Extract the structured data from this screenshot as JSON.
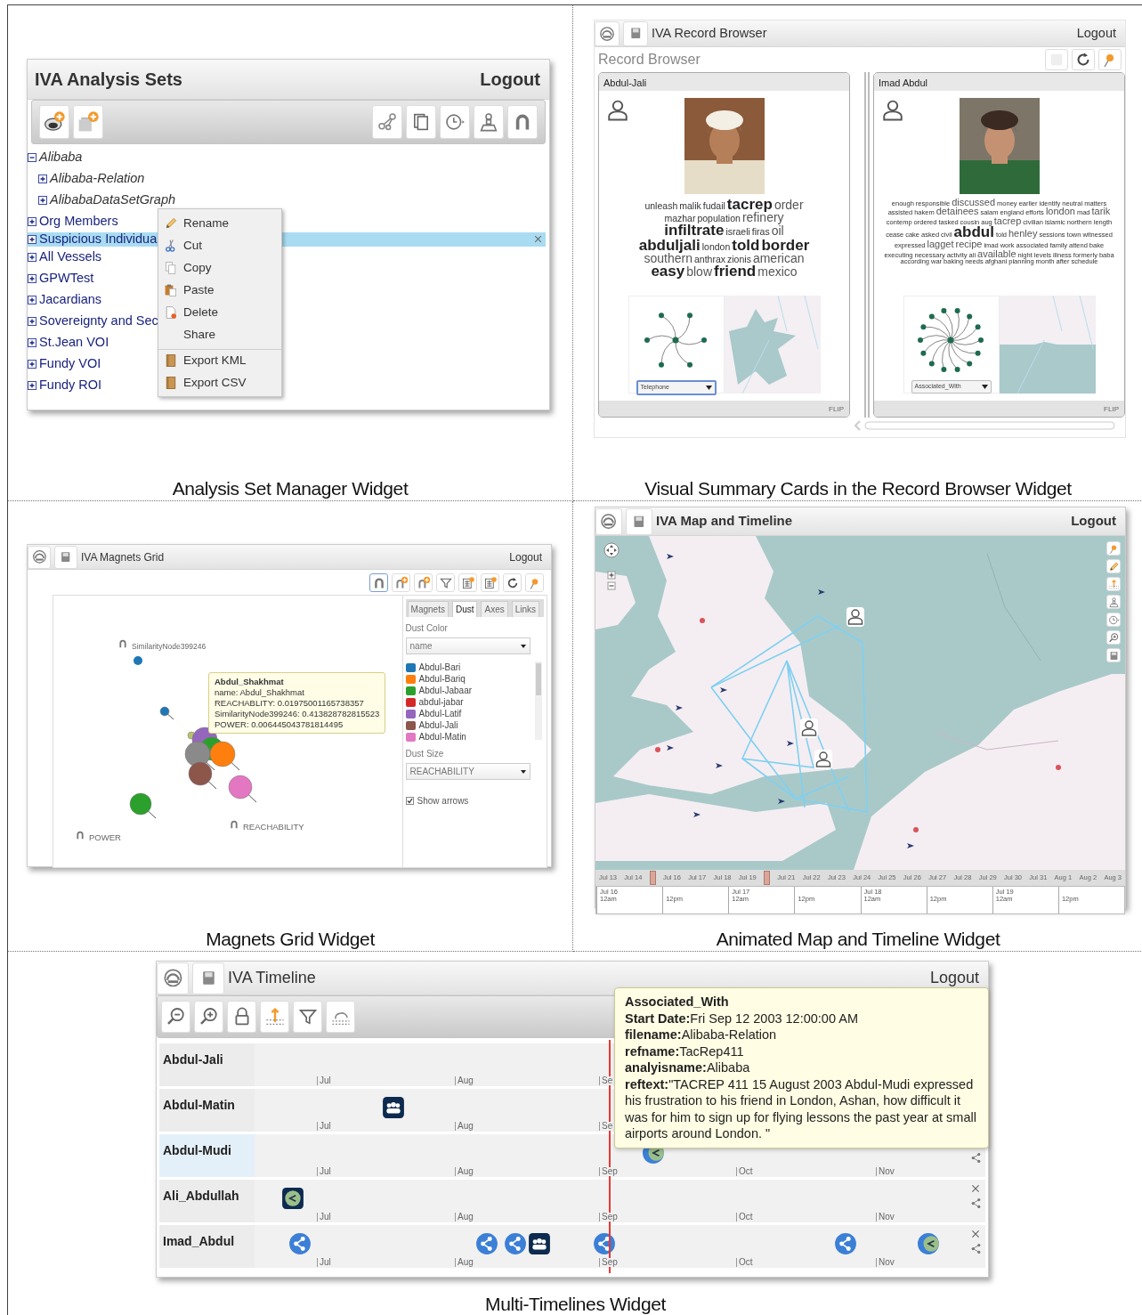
{
  "analysis_sets": {
    "title": "IVA Analysis Sets",
    "logout": "Logout",
    "caption": "Analysis Set Manager Widget",
    "tree": [
      {
        "label": "Alibaba",
        "kind": "dataset",
        "expanded": true,
        "selected": false,
        "children": [
          {
            "label": "Alibaba-Relation",
            "kind": "dataset",
            "expanded": false,
            "selected": false
          },
          {
            "label": "AlibabaDataSetGraph",
            "kind": "dataset",
            "expanded": false,
            "selected": false
          }
        ]
      },
      {
        "label": "Org Members",
        "kind": "set",
        "expanded": false,
        "selected": false
      },
      {
        "label": "Suspicious Individua",
        "kind": "set",
        "expanded": false,
        "selected": true
      },
      {
        "label": "All Vessels",
        "kind": "set",
        "expanded": false,
        "selected": false
      },
      {
        "label": "GPWTest",
        "kind": "set",
        "expanded": false,
        "selected": false
      },
      {
        "label": "Jacardians",
        "kind": "set",
        "expanded": false,
        "selected": false
      },
      {
        "label": "Sovereignty and Sec",
        "kind": "set",
        "expanded": false,
        "selected": false
      },
      {
        "label": "St.Jean VOI",
        "kind": "set",
        "expanded": false,
        "selected": false
      },
      {
        "label": "Fundy VOI",
        "kind": "set",
        "expanded": false,
        "selected": false
      },
      {
        "label": "Fundy ROI",
        "kind": "set",
        "expanded": false,
        "selected": false
      }
    ],
    "menu": [
      {
        "label": "Rename",
        "icon": true,
        "divider_before": false
      },
      {
        "label": "Cut",
        "icon": true,
        "divider_before": false
      },
      {
        "label": "Copy",
        "icon": true,
        "divider_before": false
      },
      {
        "label": "Paste",
        "icon": true,
        "divider_before": false
      },
      {
        "label": "Delete",
        "icon": true,
        "divider_before": false
      },
      {
        "label": "Share",
        "icon": false,
        "divider_before": false
      },
      {
        "label": "Export KML",
        "icon": true,
        "divider_before": true
      },
      {
        "label": "Export CSV",
        "icon": true,
        "divider_before": false
      }
    ]
  },
  "record_browser": {
    "title": "IVA Record Browser",
    "logout": "Logout",
    "subtitle": "Record Browser",
    "caption": "Visual Summary Cards in the Record Browser Widget",
    "cards": [
      {
        "name": "Abdul-Jali",
        "relation": "Telephone",
        "focused": true,
        "footer": "FLIP",
        "cloud": [
          {
            "word": "unleash",
            "bold": false,
            "large": false
          },
          {
            "word": "malik",
            "bold": false,
            "large": false
          },
          {
            "word": "fudail",
            "bold": false,
            "large": false
          },
          {
            "word": "tacrep",
            "bold": true,
            "large": true
          },
          {
            "word": "order",
            "bold": false,
            "large": true
          },
          {
            "word": "mazhar",
            "bold": false,
            "large": false
          },
          {
            "word": "population",
            "bold": false,
            "large": false
          },
          {
            "word": "refinery",
            "bold": false,
            "large": true
          },
          {
            "word": "infiltrate",
            "bold": true,
            "large": true
          },
          {
            "word": "israeli",
            "bold": false,
            "large": false
          },
          {
            "word": "firas",
            "bold": false,
            "large": false
          },
          {
            "word": "oil",
            "bold": false,
            "large": true
          },
          {
            "word": "abduljali",
            "bold": true,
            "large": true
          },
          {
            "word": "london",
            "bold": false,
            "large": false
          },
          {
            "word": "told",
            "bold": true,
            "large": true
          },
          {
            "word": "border",
            "bold": true,
            "large": true
          },
          {
            "word": "southern",
            "bold": false,
            "large": true
          },
          {
            "word": "anthrax",
            "bold": false,
            "large": false
          },
          {
            "word": "zionis",
            "bold": false,
            "large": false
          },
          {
            "word": "american",
            "bold": false,
            "large": true
          },
          {
            "word": "easy",
            "bold": true,
            "large": true
          },
          {
            "word": "blow",
            "bold": false,
            "large": true
          },
          {
            "word": "friend",
            "bold": true,
            "large": true
          },
          {
            "word": "mexico",
            "bold": false,
            "large": true
          }
        ]
      },
      {
        "name": "Imad Abdul",
        "relation": "Associated_With",
        "focused": false,
        "footer": "FLIP",
        "cloud": [
          {
            "word": "enough",
            "bold": false,
            "large": false
          },
          {
            "word": "responsible",
            "bold": false,
            "large": false
          },
          {
            "word": "discussed",
            "bold": false,
            "large": true
          },
          {
            "word": "money",
            "bold": false,
            "large": false
          },
          {
            "word": "earlier",
            "bold": false,
            "large": false
          },
          {
            "word": "identify",
            "bold": false,
            "large": false
          },
          {
            "word": "neutral",
            "bold": false,
            "large": false
          },
          {
            "word": "matters",
            "bold": false,
            "large": false
          },
          {
            "word": "assisted",
            "bold": false,
            "large": false
          },
          {
            "word": "hakem",
            "bold": false,
            "large": false
          },
          {
            "word": "detainees",
            "bold": false,
            "large": true
          },
          {
            "word": "salam",
            "bold": false,
            "large": false
          },
          {
            "word": "england",
            "bold": false,
            "large": false
          },
          {
            "word": "efforts",
            "bold": false,
            "large": false
          },
          {
            "word": "london",
            "bold": false,
            "large": true
          },
          {
            "word": "mad",
            "bold": false,
            "large": false
          },
          {
            "word": "tarik",
            "bold": false,
            "large": true
          },
          {
            "word": "contemp",
            "bold": false,
            "large": false
          },
          {
            "word": "ordered",
            "bold": false,
            "large": false
          },
          {
            "word": "tasked",
            "bold": false,
            "large": false
          },
          {
            "word": "cousin",
            "bold": false,
            "large": false
          },
          {
            "word": "aug",
            "bold": false,
            "large": false
          },
          {
            "word": "tacrep",
            "bold": false,
            "large": true
          },
          {
            "word": "civilian",
            "bold": false,
            "large": false
          },
          {
            "word": "islamic",
            "bold": false,
            "large": false
          },
          {
            "word": "northern",
            "bold": false,
            "large": false
          },
          {
            "word": "length",
            "bold": false,
            "large": false
          },
          {
            "word": "cease",
            "bold": false,
            "large": false
          },
          {
            "word": "cake",
            "bold": false,
            "large": false
          },
          {
            "word": "asked",
            "bold": false,
            "large": false
          },
          {
            "word": "civil",
            "bold": false,
            "large": false
          },
          {
            "word": "abdul",
            "bold": true,
            "large": true
          },
          {
            "word": "told",
            "bold": false,
            "large": false
          },
          {
            "word": "henley",
            "bold": false,
            "large": true
          },
          {
            "word": "sessions",
            "bold": false,
            "large": false
          },
          {
            "word": "town",
            "bold": false,
            "large": false
          },
          {
            "word": "witnessed",
            "bold": false,
            "large": false
          },
          {
            "word": "expressed",
            "bold": false,
            "large": false
          },
          {
            "word": "lagget",
            "bold": false,
            "large": true
          },
          {
            "word": "recipe",
            "bold": false,
            "large": true
          },
          {
            "word": "imad",
            "bold": false,
            "large": false
          },
          {
            "word": "work",
            "bold": false,
            "large": false
          },
          {
            "word": "associated",
            "bold": false,
            "large": false
          },
          {
            "word": "family",
            "bold": false,
            "large": false
          },
          {
            "word": "attend",
            "bold": false,
            "large": false
          },
          {
            "word": "bake",
            "bold": false,
            "large": false
          },
          {
            "word": "executing",
            "bold": false,
            "large": false
          },
          {
            "word": "necessary",
            "bold": false,
            "large": false
          },
          {
            "word": "activity",
            "bold": false,
            "large": false
          },
          {
            "word": "ali",
            "bold": false,
            "large": false
          },
          {
            "word": "available",
            "bold": false,
            "large": true
          },
          {
            "word": "night",
            "bold": false,
            "large": false
          },
          {
            "word": "levels",
            "bold": false,
            "large": false
          },
          {
            "word": "illness",
            "bold": false,
            "large": false
          },
          {
            "word": "formerly",
            "bold": false,
            "large": false
          },
          {
            "word": "baba",
            "bold": false,
            "large": false
          },
          {
            "word": "according",
            "bold": false,
            "large": false
          },
          {
            "word": "war",
            "bold": false,
            "large": false
          },
          {
            "word": "baking",
            "bold": false,
            "large": false
          },
          {
            "word": "needs",
            "bold": false,
            "large": false
          },
          {
            "word": "afghani",
            "bold": false,
            "large": false
          },
          {
            "word": "planning",
            "bold": false,
            "large": false
          },
          {
            "word": "month",
            "bold": false,
            "large": false
          },
          {
            "word": "after",
            "bold": false,
            "large": false
          },
          {
            "word": "schedule",
            "bold": false,
            "large": false
          }
        ]
      }
    ]
  },
  "magnets_grid": {
    "title": "IVA Magnets Grid",
    "logout": "Logout",
    "caption": "Magnets Grid Widget",
    "magnets": [
      {
        "label": "SimilarityNode399246"
      },
      {
        "label": "REACHABILITY"
      },
      {
        "label": "POWER"
      }
    ],
    "tooltip": {
      "title": "Abdul_Shakhmat",
      "lines": [
        "name: Abdul_Shakhmat",
        "REACHABLITY: 0.01975001165738357",
        "SimilarityNode399246: 0.413828782815523",
        "POWER: 0.006445043781814495"
      ]
    },
    "tabs": [
      {
        "label": "Magnets",
        "selected": false
      },
      {
        "label": "Dust",
        "selected": true
      },
      {
        "label": "Axes",
        "selected": false
      },
      {
        "label": "Links",
        "selected": false
      }
    ],
    "dust_color": {
      "label": "Dust Color",
      "value": "name"
    },
    "legend": [
      {
        "label": "Abdul-Bari",
        "color": "#1f77b4"
      },
      {
        "label": "Abdul-Bariq",
        "color": "#ff7f0e"
      },
      {
        "label": "Abdul-Jabaar",
        "color": "#2ca02c"
      },
      {
        "label": "abdul-jabar",
        "color": "#d62728"
      },
      {
        "label": "Abdul-Latif",
        "color": "#9467bd"
      },
      {
        "label": "Abdul-Jali",
        "color": "#8c564b"
      },
      {
        "label": "Abdul-Matin",
        "color": "#e377c2"
      }
    ],
    "dust_size": {
      "label": "Dust Size",
      "value": "REACHABILITY"
    },
    "show_arrows": {
      "label": "Show arrows",
      "checked": true
    }
  },
  "map_timeline": {
    "title": "IVA Map and Timeline",
    "logout": "Logout",
    "caption": "Animated Map and Timeline Widget",
    "overview": [
      {
        "kind": "tick",
        "label": "Jul 13"
      },
      {
        "kind": "tick",
        "label": "Jul 14"
      },
      {
        "kind": "handle"
      },
      {
        "kind": "tick",
        "label": "Jul 16"
      },
      {
        "kind": "tick",
        "label": "Jul 17"
      },
      {
        "kind": "tick",
        "label": "Jul 18"
      },
      {
        "kind": "tick",
        "label": "Jul 19"
      },
      {
        "kind": "handle"
      },
      {
        "kind": "tick",
        "label": "Jul 21"
      },
      {
        "kind": "tick",
        "label": "Jul 22"
      },
      {
        "kind": "tick",
        "label": "Jul 23"
      },
      {
        "kind": "tick",
        "label": "Jul 24"
      },
      {
        "kind": "tick",
        "label": "Jul 25"
      },
      {
        "kind": "tick",
        "label": "Jul 26"
      },
      {
        "kind": "tick",
        "label": "Jul 27"
      },
      {
        "kind": "tick",
        "label": "Jul 28"
      },
      {
        "kind": "tick",
        "label": "Jul 29"
      },
      {
        "kind": "tick",
        "label": "Jul 30"
      },
      {
        "kind": "tick",
        "label": "Jul 31"
      },
      {
        "kind": "tick",
        "label": "Aug 1"
      },
      {
        "kind": "tick",
        "label": "Aug 2"
      },
      {
        "kind": "tick",
        "label": "Aug 3"
      }
    ],
    "detail": [
      {
        "day": "Jul 16",
        "time": "12am"
      },
      {
        "time": "12pm"
      },
      {
        "day": "Jul 17",
        "time": "12am"
      },
      {
        "time": "12pm"
      },
      {
        "day": "Jul 18",
        "time": "12am"
      },
      {
        "time": "12pm"
      },
      {
        "day": "Jul 19",
        "time": "12am"
      },
      {
        "time": "12pm"
      }
    ]
  },
  "timeline": {
    "title": "IVA Timeline",
    "logout": "Logout",
    "caption": "Multi-Timelines Widget",
    "rows": [
      {
        "name": "Abdul-Jali",
        "selected": false,
        "ticks": [
          "Jul",
          "Aug",
          "Se"
        ],
        "events": [],
        "close_button": false,
        "share_button": false
      },
      {
        "name": "Abdul-Matin",
        "selected": false,
        "ticks": [
          "Jul",
          "Aug",
          "Se"
        ],
        "events": [
          {
            "kind": "group"
          }
        ],
        "close_button": false,
        "share_button": false
      },
      {
        "name": "Abdul-Mudi",
        "selected": true,
        "ticks": [
          "Jul",
          "Aug",
          "Sep",
          "Oct",
          "Nov"
        ],
        "events": [
          {
            "kind": "chatlink"
          }
        ],
        "close_button": false,
        "share_button": true
      },
      {
        "name": "Ali_Abdullah",
        "selected": false,
        "ticks": [
          "Jul",
          "Aug",
          "Sep",
          "Oct",
          "Nov"
        ],
        "events": [
          {
            "kind": "chat"
          }
        ],
        "close_button": true,
        "share_button": true
      },
      {
        "name": "Imad_Abdul",
        "selected": false,
        "ticks": [
          "Jul",
          "Aug",
          "Sep",
          "Oct",
          "Nov"
        ],
        "events": [
          {
            "kind": "share"
          },
          {
            "kind": "share"
          },
          {
            "kind": "share"
          },
          {
            "kind": "group"
          },
          {
            "kind": "share"
          },
          {
            "kind": "share"
          },
          {
            "kind": "chatlink"
          }
        ],
        "close_button": true,
        "share_button": true
      }
    ],
    "tooltip": {
      "title": "Associated_With",
      "lines": [
        "**Start Date:**Fri Sep 12 2003 12:00:00 AM",
        "**filename:**Alibaba-Relation",
        "**refname:**TacRep411",
        "**analyisname:**Alibaba",
        "**reftext:**\"TACREP 411 15 August 2003 Abdul-Mudi expressed his frustration to his friend in London, Ashan, how difficult it was for him to sign up for flying lessons the past year at small airports around London. \""
      ]
    }
  }
}
